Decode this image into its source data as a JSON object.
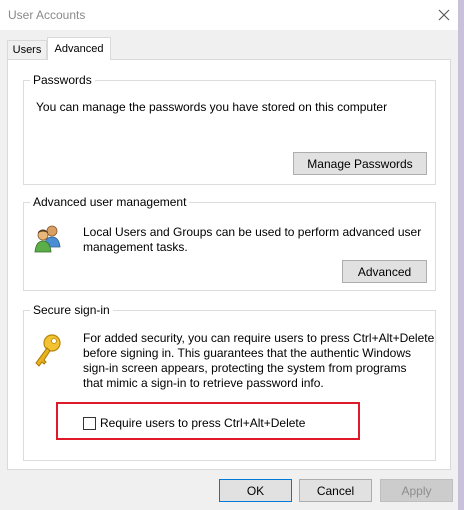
{
  "window": {
    "title": "User Accounts"
  },
  "tabs": [
    {
      "label": "Users"
    },
    {
      "label": "Advanced"
    }
  ],
  "passwords": {
    "title": "Passwords",
    "text": "You can manage the passwords you have stored on this computer",
    "button": "Manage Passwords"
  },
  "advanced_management": {
    "title": "Advanced user management",
    "text_line1": "Local Users and Groups can be used to perform advanced user",
    "text_line2": "management tasks.",
    "button": "Advanced"
  },
  "secure_signin": {
    "title": "Secure sign-in",
    "lines": [
      "For added security, you can require users to press Ctrl+Alt+Delete",
      "before signing in. This guarantees that the authentic Windows",
      "sign-in screen appears, protecting the system from programs",
      "that mimic a sign-in to retrieve password info."
    ],
    "checkbox_label": "Require users to press Ctrl+Alt+Delete",
    "checkbox_checked": false
  },
  "footer": {
    "ok": "OK",
    "cancel": "Cancel",
    "apply": "Apply"
  },
  "colors": {
    "highlight": "#e0192a",
    "focus": "#0078d7"
  }
}
